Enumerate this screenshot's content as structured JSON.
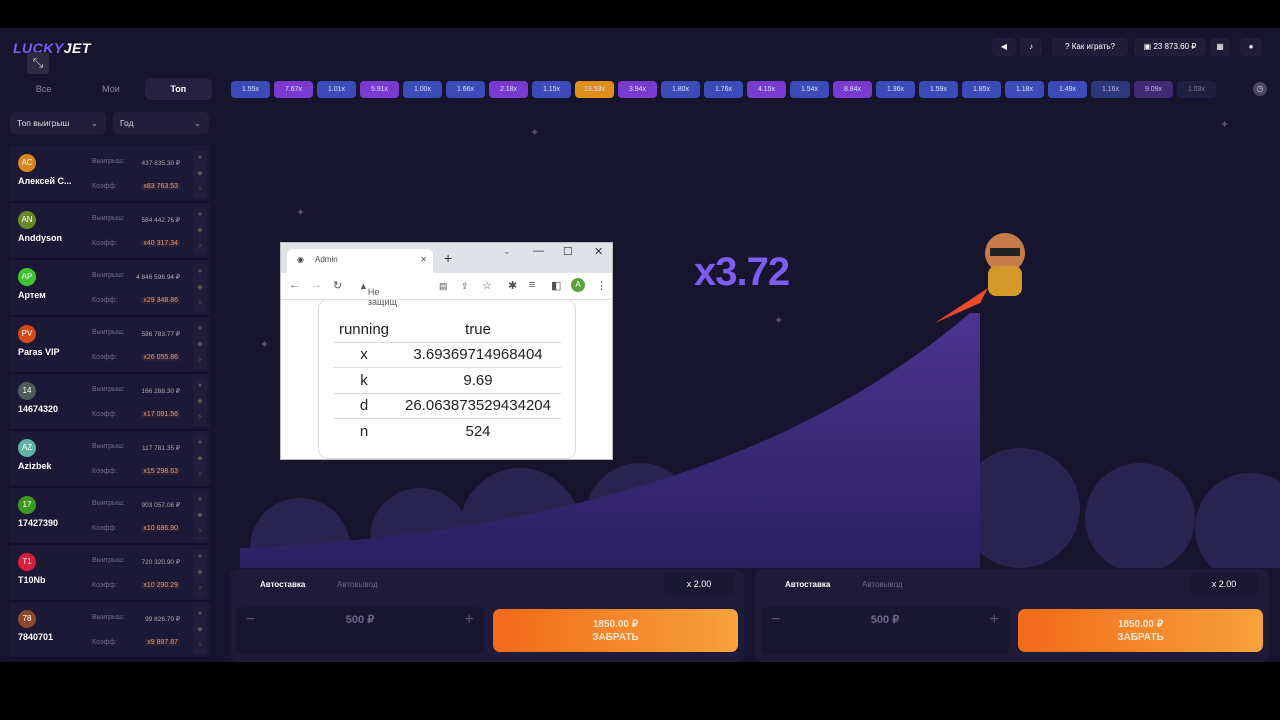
{
  "app": {
    "logo_left": "LUCKY",
    "logo_right": "JET"
  },
  "sidebar": {
    "tabs": [
      "Все",
      "Мои",
      "Топ"
    ],
    "active_tab": "Топ",
    "filter1": "Топ выигрыш",
    "filter2": "Год",
    "win_label": "Выигрыш:",
    "coef_label": "Коэфф:",
    "players": [
      {
        "initials": "AC",
        "name": "Алексей С...",
        "win": "437 835.30 ₽",
        "coef": "x83 763.53",
        "color": "#d9851f"
      },
      {
        "initials": "AN",
        "name": "Anddyson",
        "win": "584 442.76 ₽",
        "coef": "x40 317.34",
        "color": "#6a8a2a"
      },
      {
        "initials": "AP",
        "name": "Артем",
        "win": "4 846 596.94 ₽",
        "coef": "x29 348.86",
        "color": "#3ec431"
      },
      {
        "initials": "PV",
        "name": "Paras VIP",
        "win": "586 783.77 ₽",
        "coef": "x26 055.86",
        "color": "#d24a1c"
      },
      {
        "initials": "14",
        "name": "14674320",
        "win": "166 288.30 ₽",
        "coef": "x17 091.56",
        "color": "#4f5a5a"
      },
      {
        "initials": "AZ",
        "name": "Azizbek",
        "win": "117 781.35 ₽",
        "coef": "x15 298.63",
        "color": "#5fb3a5"
      },
      {
        "initials": "17",
        "name": "17427390",
        "win": "903 057.06 ₽",
        "coef": "x10 686.90",
        "color": "#3a9a20"
      },
      {
        "initials": "T1",
        "name": "T10Nb",
        "win": "720 320.90 ₽",
        "coef": "x10 290.29",
        "color": "#d81e3c"
      },
      {
        "initials": "78",
        "name": "7840701",
        "win": "99 826.70 ₽",
        "coef": "x9 897.87",
        "color": "#8a4a2a"
      }
    ]
  },
  "multipliers": [
    {
      "v": "1.55x",
      "c": "#3b4cb8"
    },
    {
      "v": "7.67x",
      "c": "#7a3ad0"
    },
    {
      "v": "1.01x",
      "c": "#3b4cb8"
    },
    {
      "v": "5.91x",
      "c": "#7a3ad0"
    },
    {
      "v": "1.00x",
      "c": "#3b4cb8"
    },
    {
      "v": "1.66x",
      "c": "#3b4cb8"
    },
    {
      "v": "2.18x",
      "c": "#7a3ad0"
    },
    {
      "v": "1.15x",
      "c": "#3b4cb8"
    },
    {
      "v": "13.53x",
      "c": "#e0901a"
    },
    {
      "v": "3.94x",
      "c": "#7a3ad0"
    },
    {
      "v": "1.80x",
      "c": "#3b4cb8"
    },
    {
      "v": "1.76x",
      "c": "#3b4cb8"
    },
    {
      "v": "4.15x",
      "c": "#7a3ad0"
    },
    {
      "v": "1.54x",
      "c": "#3b4cb8"
    },
    {
      "v": "8.84x",
      "c": "#7a3ad0"
    },
    {
      "v": "1.36x",
      "c": "#3b4cb8"
    },
    {
      "v": "1.59x",
      "c": "#3b4cb8"
    },
    {
      "v": "1.85x",
      "c": "#3b4cb8"
    },
    {
      "v": "1.18x",
      "c": "#3b4cb8"
    },
    {
      "v": "1.49x",
      "c": "#3b4cb8"
    },
    {
      "v": "1.16x",
      "c": "#33408f"
    },
    {
      "v": "9.09x",
      "c": "#4d2f86"
    },
    {
      "v": "1.03x",
      "c": "#262a55"
    }
  ],
  "header": {
    "how_to_play": "Как играть?",
    "balance": "23 873.60 ₽"
  },
  "game": {
    "multiplier": "x3.72"
  },
  "panels": [
    {
      "tab1": "Автоставка",
      "tab2": "Автовывод",
      "coef": "x 2.00",
      "bet": "500 ₽",
      "cash_amount": "1850.00 ₽",
      "cash_label": "ЗАБРАТЬ"
    },
    {
      "tab1": "Автоставка",
      "tab2": "Автовывод",
      "coef": "x 2.00",
      "bet": "500 ₽",
      "cash_amount": "1850.00 ₽",
      "cash_label": "ЗАБРАТЬ"
    }
  ],
  "browser": {
    "tab_title": "Admin",
    "address": "Не защищ",
    "profile": "A",
    "rows": [
      {
        "k": "running",
        "v": "true"
      },
      {
        "k": "x",
        "v": "3.69369714968404"
      },
      {
        "k": "k",
        "v": "9.69"
      },
      {
        "k": "d",
        "v": "26.063873529434204"
      },
      {
        "k": "n",
        "v": "524"
      }
    ]
  }
}
